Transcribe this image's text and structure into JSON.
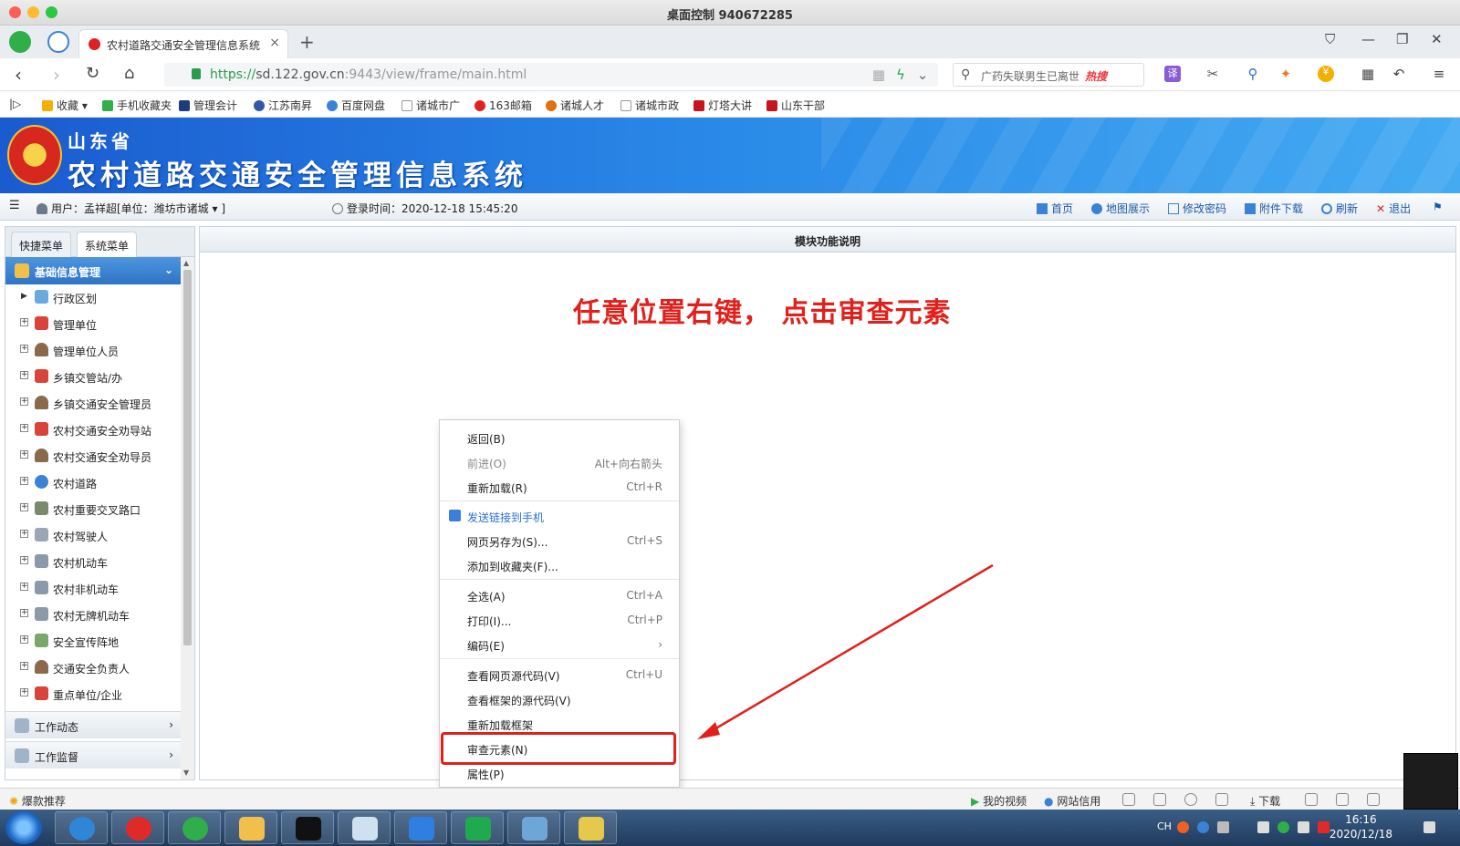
{
  "window": {
    "title": "桌面控制 940672285"
  },
  "tabs": {
    "active_title": "农村道路交通安全管理信息系统"
  },
  "address_bar": {
    "url_protocol": "https://",
    "url_host": "sd.122.gov.cn",
    "url_rest": ":9443/view/frame/main.html",
    "search_placeholder": "广药失联男生已离世",
    "search_hot": "热搜"
  },
  "bookmarks": [
    "收藏",
    "手机收藏夹",
    "管理会计",
    "江苏南昇",
    "百度网盘",
    "诸城市广",
    "163邮箱",
    "诸城人才",
    "诸城市政",
    "灯塔大讲",
    "山东干部"
  ],
  "banner": {
    "province": "山东省",
    "system_name": "农村道路交通安全管理信息系统"
  },
  "user_bar": {
    "user": "用户：孟祥超[单位：潍坊市诸城 ▾ ]",
    "login_time": "登录时间：2020-12-18 15:45:20",
    "links": [
      "首页",
      "地图展示",
      "修改密码",
      "附件下载",
      "刷新",
      "退出"
    ]
  },
  "left_panel": {
    "tabs": [
      "快捷菜单",
      "系统菜单"
    ],
    "active_section": "基础信息管理",
    "tree_items": [
      "行政区划",
      "管理单位",
      "管理单位人员",
      "乡镇交管站/办",
      "乡镇交通安全管理员",
      "农村交通安全劝导站",
      "农村交通安全劝导员",
      "农村道路",
      "农村重要交叉路口",
      "农村驾驶人",
      "农村机动车",
      "农村非机动车",
      "农村无牌机动车",
      "安全宣传阵地",
      "交通安全负责人",
      "重点单位/企业"
    ],
    "collapsed_sections": [
      "工作动态",
      "工作监督"
    ]
  },
  "main": {
    "header": "模块功能说明",
    "annotation": "任意位置右键， 点击审查元素"
  },
  "context_menu": [
    {
      "label": "返回(B)",
      "shortcut": ""
    },
    {
      "label": "前进(O)",
      "shortcut": "Alt+向右箭头"
    },
    {
      "label": "重新加载(R)",
      "shortcut": "Ctrl+R"
    },
    {
      "label": "发送链接到手机",
      "shortcut": ""
    },
    {
      "label": "网页另存为(S)...",
      "shortcut": "Ctrl+S"
    },
    {
      "label": "添加到收藏夹(F)...",
      "shortcut": ""
    },
    {
      "label": "全选(A)",
      "shortcut": "Ctrl+A"
    },
    {
      "label": "打印(I)...",
      "shortcut": "Ctrl+P"
    },
    {
      "label": "编码(E)",
      "shortcut": "›"
    },
    {
      "label": "查看网页源代码(V)",
      "shortcut": "Ctrl+U"
    },
    {
      "label": "查看框架的源代码(V)",
      "shortcut": ""
    },
    {
      "label": "重新加载框架",
      "shortcut": ""
    },
    {
      "label": "审查元素(N)",
      "shortcut": ""
    },
    {
      "label": "属性(P)",
      "shortcut": ""
    }
  ],
  "status_bar": {
    "left": "爆款推荐",
    "my_video": "我的视频",
    "site_credit": "网站信用",
    "download": "下载"
  },
  "taskbar": {
    "lang": "CH",
    "time": "16:16",
    "date": "2020/12/18"
  },
  "colors": {
    "banner": "#2a8ae8",
    "annotation": "#e0211b",
    "active_section": "#2f74c6"
  }
}
